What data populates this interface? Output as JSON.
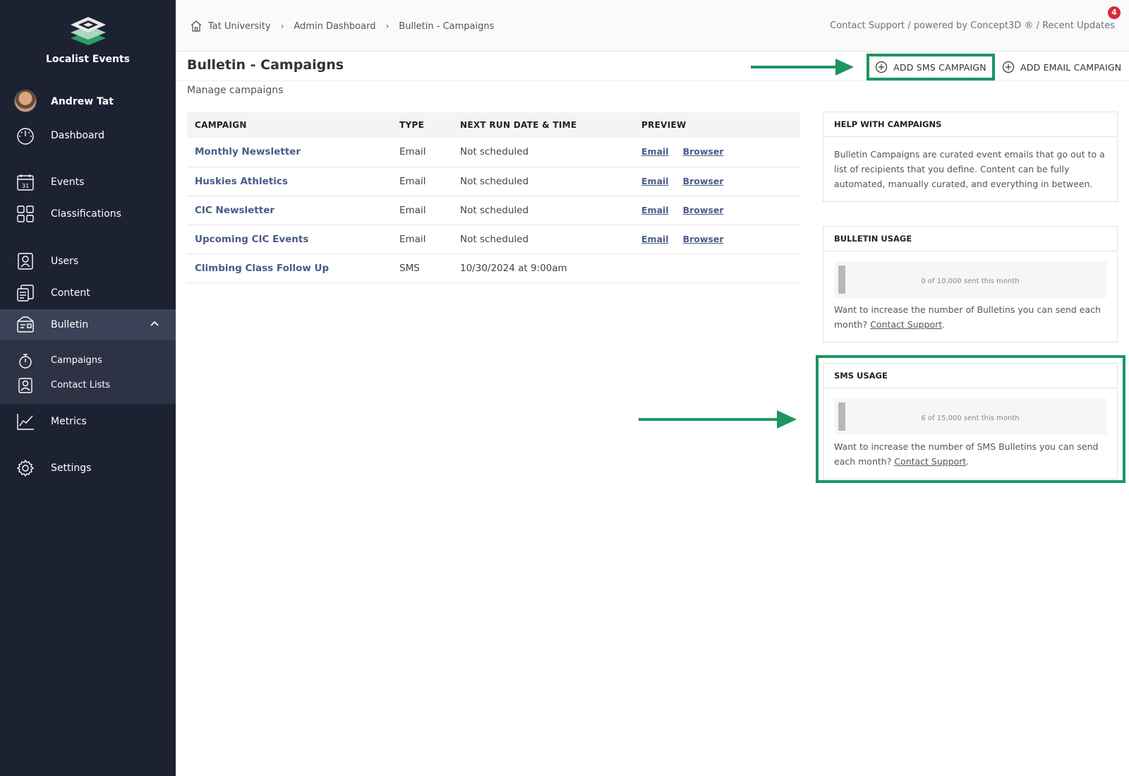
{
  "brand": {
    "name": "Localist Events"
  },
  "user": {
    "name": "Andrew Tat"
  },
  "sidebar": {
    "items": [
      {
        "label": "Dashboard"
      },
      {
        "label": "Events"
      },
      {
        "label": "Classifications"
      },
      {
        "label": "Users"
      },
      {
        "label": "Content"
      },
      {
        "label": "Bulletin"
      },
      {
        "label": "Metrics"
      },
      {
        "label": "Settings"
      }
    ],
    "bulletin_sub": [
      {
        "label": "Campaigns"
      },
      {
        "label": "Contact Lists"
      }
    ],
    "calendar_day": "31"
  },
  "breadcrumb": [
    "Tat University",
    "Admin Dashboard",
    "Bulletin - Campaigns"
  ],
  "breadcrumb_sep": "›",
  "toplinks": "Contact Support / powered by Concept3D ® / Recent Updates",
  "notification_count": "4",
  "page": {
    "title": "Bulletin - Campaigns",
    "subtitle": "Manage campaigns",
    "add_sms": "ADD SMS CAMPAIGN",
    "add_email": "ADD EMAIL CAMPAIGN"
  },
  "table": {
    "headers": [
      "CAMPAIGN",
      "TYPE",
      "NEXT RUN DATE & TIME",
      "PREVIEW"
    ],
    "rows": [
      {
        "name": "Monthly Newsletter",
        "type": "Email",
        "next": "Not scheduled",
        "preview_email": "Email",
        "preview_browser": "Browser"
      },
      {
        "name": "Huskies Athletics",
        "type": "Email",
        "next": "Not scheduled",
        "preview_email": "Email",
        "preview_browser": "Browser"
      },
      {
        "name": "CIC Newsletter",
        "type": "Email",
        "next": "Not scheduled",
        "preview_email": "Email",
        "preview_browser": "Browser"
      },
      {
        "name": "Upcoming CIC Events",
        "type": "Email",
        "next": "Not scheduled",
        "preview_email": "Email",
        "preview_browser": "Browser"
      },
      {
        "name": "Climbing Class Follow Up",
        "type": "SMS",
        "next": "10/30/2024 at 9:00am"
      }
    ]
  },
  "help": {
    "title": "HELP WITH CAMPAIGNS",
    "body": "Bulletin Campaigns are curated event emails that go out to a list of recipients that you define. Content can be fully automated, manually curated, and everything in between."
  },
  "bulletin_usage": {
    "title": "BULLETIN USAGE",
    "meter": "0 of 10,000 sent this month",
    "text": "Want to increase the number of Bulletins you can send each month?",
    "link": "Contact Support",
    "end": "."
  },
  "sms_usage": {
    "title": "SMS USAGE",
    "meter": "6 of 15,000 sent this month",
    "text": "Want to increase the number of SMS Bulletins you can send each month?",
    "link": "Contact Support",
    "end": "."
  },
  "colors": {
    "sidebar": "#1d2232",
    "accent_green": "#1e9461",
    "link": "#4a5a8a",
    "badge": "#d9283c"
  }
}
